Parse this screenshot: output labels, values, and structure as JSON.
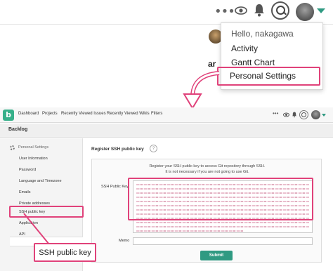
{
  "colors": {
    "accent": "#2f9a82",
    "highlight": "#e0427a",
    "logo": "#37b08a"
  },
  "zoom_header": {
    "more_icon": "more-dots-icon",
    "watch_icon": "eye-icon",
    "notification_icon": "bell-icon",
    "search_icon": "search-icon",
    "partial_text": "ar"
  },
  "user_menu": {
    "greeting": "Hello, nakagawa",
    "items": [
      "Activity",
      "Gantt Chart",
      "Personal Settings"
    ]
  },
  "nav": {
    "logo_letter": "b",
    "items": [
      "Dashboard",
      "Projects",
      "Recently Viewed Issues",
      "Recently Viewed Wikis",
      "Filters"
    ],
    "more_label": "•••"
  },
  "backlog_title": "Backlog",
  "sidebar": {
    "heading": "Personal Settings",
    "items": [
      "User Information",
      "Password",
      "Language and Timezone",
      "Emails",
      "Private addresses",
      "SSH public key",
      "Application",
      "API"
    ]
  },
  "ssh_form": {
    "title": "Register SSH public key",
    "help": "?",
    "description_1": "Register your SSH public key to access Git repository through SSH.",
    "description_2": "It is not necessary if you are not going to use Git.",
    "key_label": "SSH Public Key",
    "memo_label": "Memo",
    "submit_label": "Submit"
  },
  "callout": {
    "text": "SSH public key"
  }
}
